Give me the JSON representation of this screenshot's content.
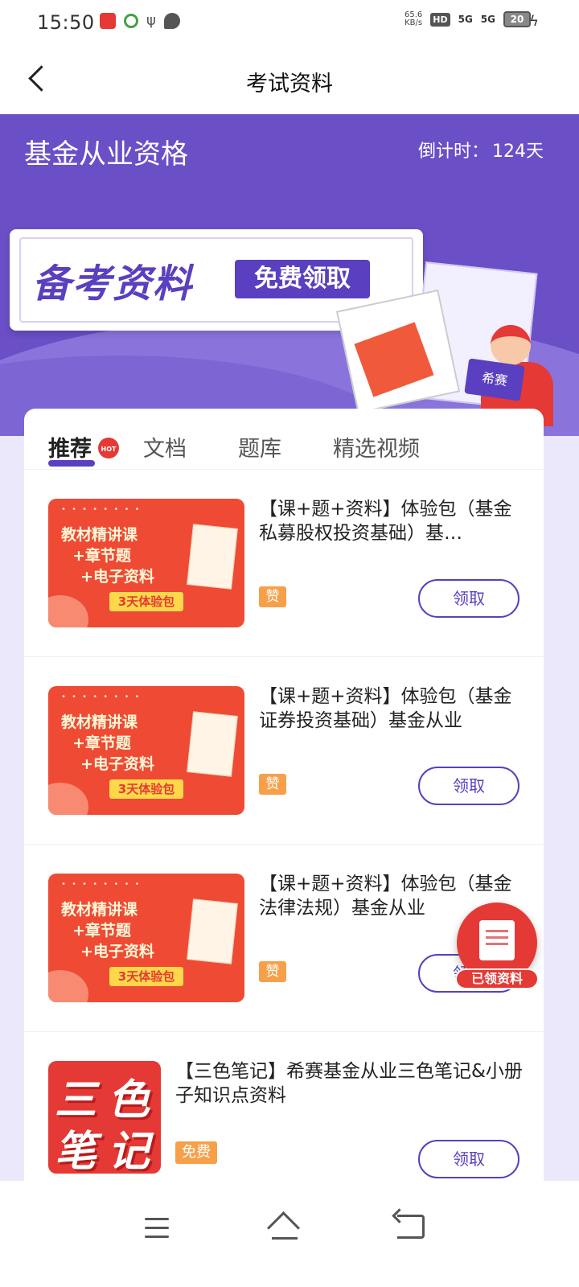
{
  "status_bar": {
    "time": "15:50",
    "net_speed_value": "65.6",
    "net_speed_unit": "KB/s",
    "hd_label": "HD",
    "signal1": "5G",
    "signal2": "5G",
    "battery": "20"
  },
  "header": {
    "title": "考试资料"
  },
  "banner": {
    "cert_title": "基金从业资格",
    "countdown_label": "倒计时：",
    "countdown_value": "124天",
    "main_text": "备考资料",
    "chip_text": "免费领取",
    "illustration_card": "希赛"
  },
  "tabs": [
    {
      "label": "推荐",
      "active": true,
      "badge": "HOT"
    },
    {
      "label": "文档",
      "active": false
    },
    {
      "label": "题库",
      "active": false
    },
    {
      "label": "精选视频",
      "active": false
    }
  ],
  "items": [
    {
      "thumb_line1": "教材精讲课",
      "thumb_line2": "+章节题",
      "thumb_line3": "+电子资料",
      "thumb_badge": "3天体验包",
      "title": "【课+题+资料】体验包（基金私募股权投资基础）基…",
      "tag": "赞",
      "button": "领取"
    },
    {
      "thumb_line1": "教材精讲课",
      "thumb_line2": "+章节题",
      "thumb_line3": "+电子资料",
      "thumb_badge": "3天体验包",
      "title": "【课+题+资料】体验包（基金证券投资基础）基金从业",
      "tag": "赞",
      "button": "领取"
    },
    {
      "thumb_line1": "教材精讲课",
      "thumb_line2": "+章节题",
      "thumb_line3": "+电子资料",
      "thumb_badge": "3天体验包",
      "title": "【课+题+资料】体验包（基金法律法规）基金从业",
      "tag": "赞",
      "button": "领取"
    }
  ],
  "notes_item": {
    "thumb_chars": [
      "三",
      "色",
      "笔",
      "记"
    ],
    "title": "【三色笔记】希赛基金从业三色笔记&小册子知识点资料",
    "tag": "免费",
    "button": "领取"
  },
  "float_button": {
    "label": "已领资料"
  },
  "colors": {
    "brand_purple": "#5a3fc0",
    "banner_bg": "#6a4fc6",
    "accent_red": "#e53935",
    "tag_orange": "#f7a04a"
  }
}
